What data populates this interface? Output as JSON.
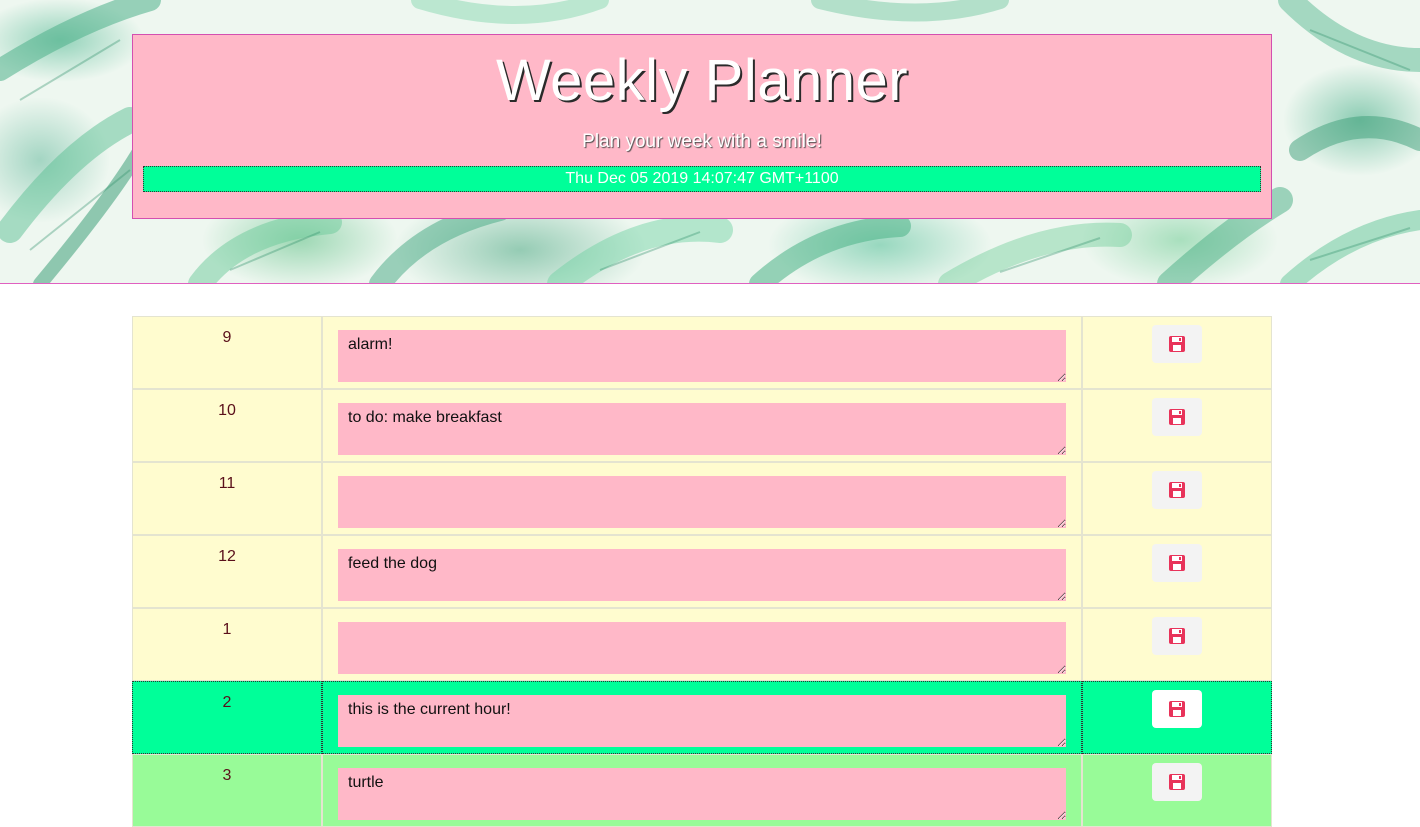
{
  "header": {
    "title": "Weekly Planner",
    "tagline": "Plan your week with a smile!",
    "current_date": "Thu Dec 05 2019 14:07:47 GMT+1100"
  },
  "colors": {
    "header_card": "#ffb8c8",
    "date_bar": "#00ff99",
    "past_row": "#fffccf",
    "present_row": "#00ff99",
    "future_row": "#98fb98",
    "textarea": "#ffb8c8",
    "save_icon": "#e8335a"
  },
  "rows": [
    {
      "hour": "9",
      "text": "alarm!",
      "state": "past"
    },
    {
      "hour": "10",
      "text": "to do: make breakfast",
      "state": "past"
    },
    {
      "hour": "11",
      "text": "",
      "state": "past"
    },
    {
      "hour": "12",
      "text": "feed the dog",
      "state": "past"
    },
    {
      "hour": "1",
      "text": "",
      "state": "past"
    },
    {
      "hour": "2",
      "text": "this is the current hour!",
      "state": "present"
    },
    {
      "hour": "3",
      "text": "turtle",
      "state": "future"
    }
  ],
  "icons": {
    "save": "floppy-disk-icon"
  }
}
